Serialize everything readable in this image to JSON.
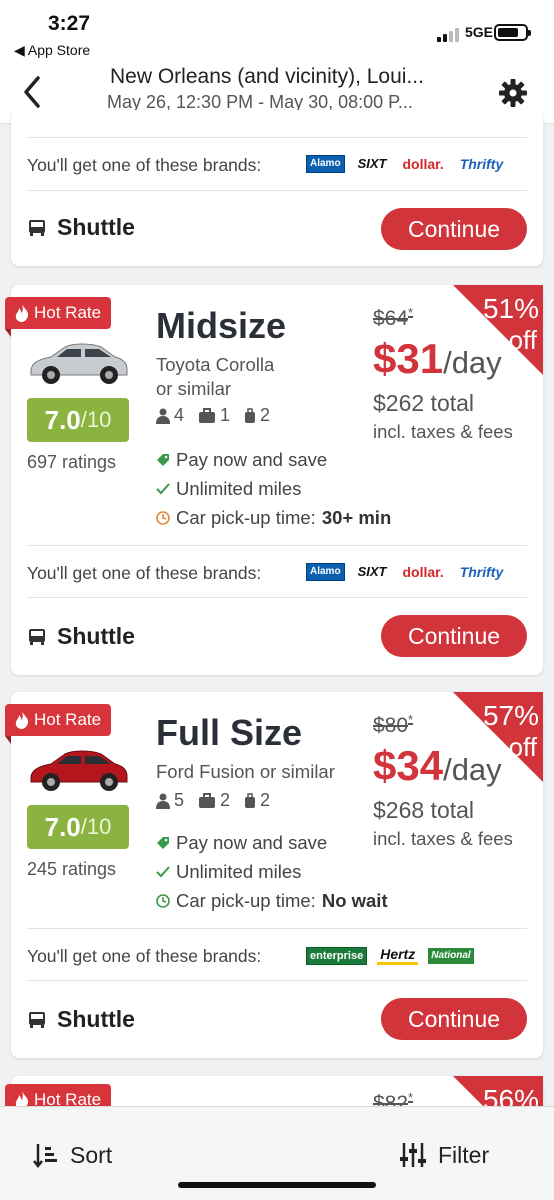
{
  "status": {
    "time": "3:27",
    "back_app": "◀ App Store",
    "network": "5GE"
  },
  "header": {
    "title": "New Orleans (and vicinity), Loui...",
    "subtitle": "May 26, 12:30 PM - May 30, 08:00 P..."
  },
  "colors": {
    "accent_red": "#d2343b",
    "rating_green": "#8ab33f"
  },
  "common": {
    "brands_label": "You'll get one of these brands:",
    "shuttle_label": "Shuttle",
    "continue_label": "Continue",
    "hot_rate_label": "Hot Rate",
    "per_day": "/day",
    "taxes_label": "incl. taxes & fees",
    "off_label": "off"
  },
  "card0": {
    "brands": [
      "Alamo",
      "SIXT",
      "dollar.",
      "Thrifty"
    ]
  },
  "card1": {
    "name": "Midsize",
    "model_line1": "Toyota Corolla",
    "model_line2": "or similar",
    "passengers": "4",
    "large_bags": "1",
    "small_bags": "2",
    "rating_score": "7.0",
    "rating_max": "/10",
    "ratings_count": "697 ratings",
    "discount": "51%",
    "old_price": "$64",
    "old_price_mark": "*",
    "price": "$31",
    "total": "$262 total",
    "features": [
      {
        "icon": "tag-icon",
        "label": "Pay now and save"
      },
      {
        "icon": "check-icon",
        "label": "Unlimited miles"
      },
      {
        "icon": "clock-icon",
        "label": "Car pick-up time:",
        "value": "30+ min"
      }
    ],
    "brands": [
      "Alamo",
      "SIXT",
      "dollar.",
      "Thrifty"
    ]
  },
  "card2": {
    "name": "Full Size",
    "model_line1": "Ford Fusion or similar",
    "passengers": "5",
    "large_bags": "2",
    "small_bags": "2",
    "rating_score": "7.0",
    "rating_max": "/10",
    "ratings_count": "245 ratings",
    "discount": "57%",
    "old_price": "$80",
    "old_price_mark": "*",
    "price": "$34",
    "total": "$268 total",
    "features": [
      {
        "icon": "tag-icon",
        "label": "Pay now and save"
      },
      {
        "icon": "check-icon",
        "label": "Unlimited miles"
      },
      {
        "icon": "clock-icon",
        "label": "Car pick-up time:",
        "value": "No wait"
      }
    ],
    "brands": [
      "enterprise",
      "Hertz",
      "National"
    ]
  },
  "card3": {
    "hot_rate": "Hot Rate",
    "old_price": "$82",
    "old_price_mark": "*",
    "discount": "56%"
  },
  "bottom": {
    "sort_label": "Sort",
    "filter_label": "Filter"
  }
}
